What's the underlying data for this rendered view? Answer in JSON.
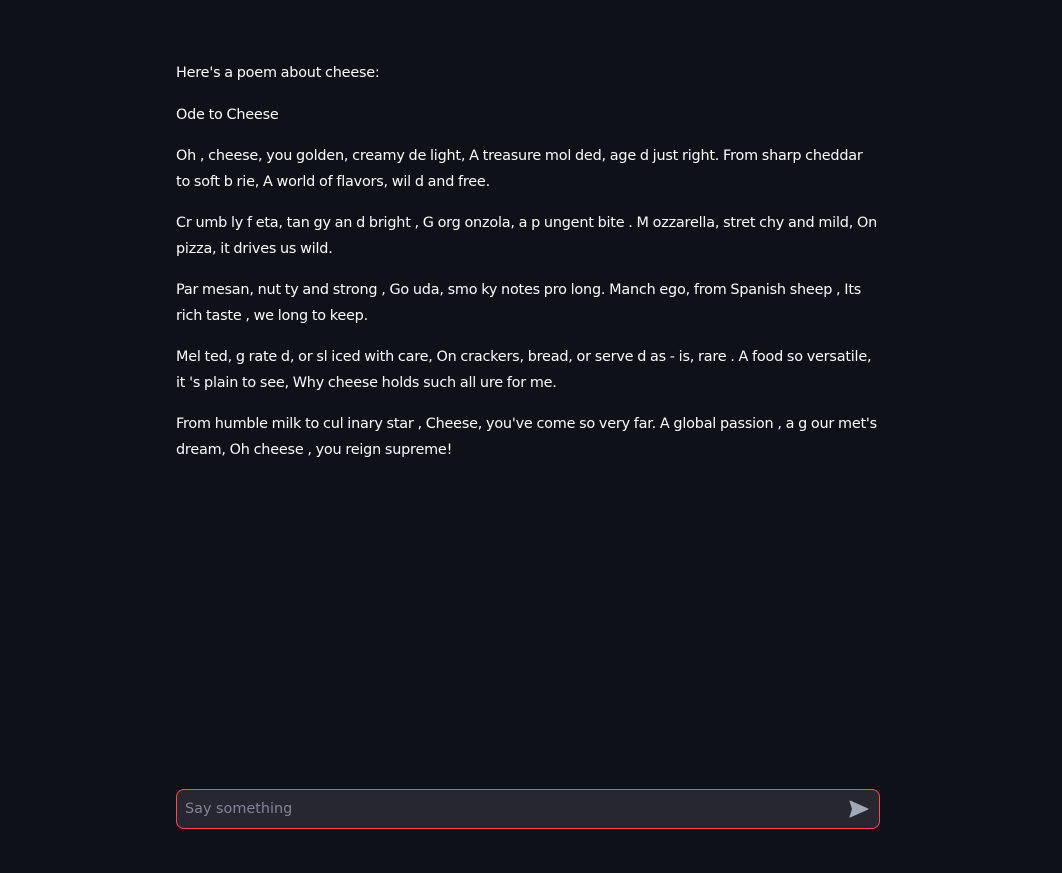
{
  "message": {
    "paragraphs": [
      "Here's a poem about cheese:",
      "Ode to Cheese",
      "Oh , cheese, you golden, creamy de light, A treasure mol ded, age d just right. From sharp cheddar to soft b rie, A world of flavors, wil d and free.",
      "Cr umb ly f eta, tan gy an d bright , G org onzola, a p ungent bite . M ozzarella, stret chy and mild, On pizza, it drives us wild.",
      "Par mesan, nut ty and strong , Go uda, smo ky notes pro long. Manch ego, from Spanish sheep , Its rich taste , we long to keep.",
      "Mel ted, g rate d, or sl iced with care, On crackers, bread, or serve d as - is, rare . A food so versatile, it 's plain to see, Why cheese holds such all ure for me.",
      "From humble milk to cul inary star , Cheese, you've come so very far. A global passion , a g our met's dream, Oh cheese , you reign supreme!"
    ]
  },
  "chat_input": {
    "placeholder": "Say something",
    "value": "",
    "send_icon": "send-icon",
    "border_color": "#ff4b4b",
    "background_color": "#262730"
  },
  "colors": {
    "page_background": "#0e1117",
    "text": "#fafafa",
    "placeholder": "#808495",
    "icon": "#a3a8b8"
  }
}
